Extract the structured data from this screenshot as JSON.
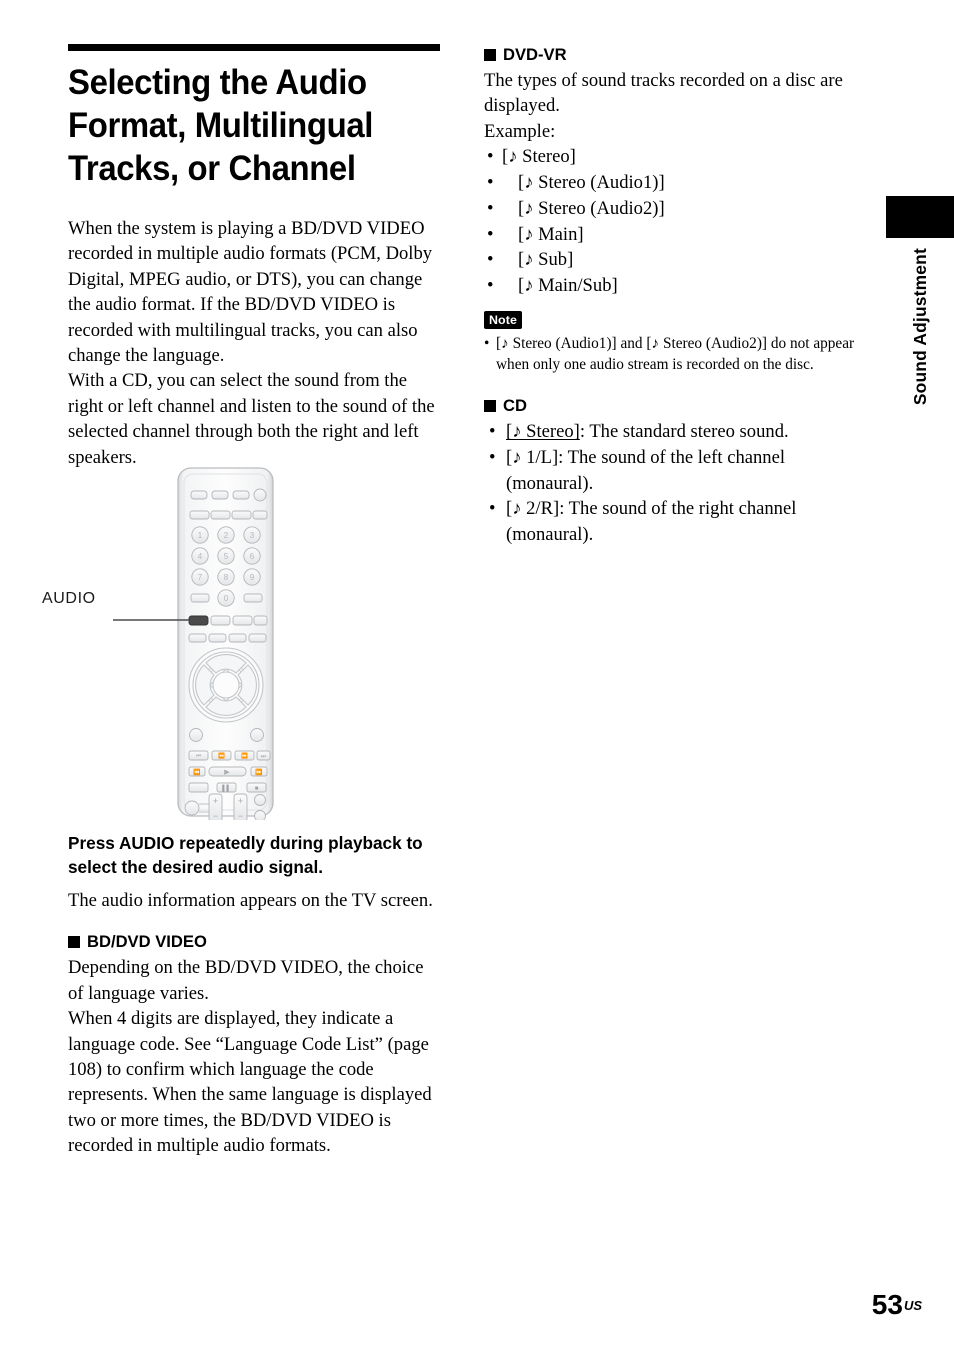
{
  "page": {
    "number": "53",
    "region_suffix": "US",
    "side_tab_label": "Sound Adjustment"
  },
  "left_column": {
    "title": "Selecting the Audio Format, Multilingual Tracks, or Channel",
    "intro_paragraphs": [
      "When the system is playing a BD/DVD VIDEO recorded in multiple audio formats (PCM, Dolby Digital, MPEG audio, or DTS), you can change the audio format. If the BD/DVD VIDEO is recorded with multilingual tracks, you can also change the language.",
      "With a CD, you can select the sound from the right or left channel and listen to the sound of the selected channel through both the right and left speakers."
    ],
    "figure": {
      "callout_label": "AUDIO",
      "keypad_digits": [
        "1",
        "2",
        "3",
        "4",
        "5",
        "6",
        "7",
        "8",
        "9",
        "0"
      ],
      "volume_plus": "+",
      "volume_minus": "−"
    },
    "instruction": "Press AUDIO repeatedly during playback to select the desired audio signal.",
    "instruction_body": "The audio information appears on the TV screen.",
    "bd_dvd_heading": "BD/DVD VIDEO",
    "bd_dvd_paragraphs": [
      "Depending on the BD/DVD VIDEO, the choice of language varies.",
      "When 4 digits are displayed, they indicate a language code. See “Language Code List” (page 108) to confirm which language the code represents. When the same language is displayed two or more times, the BD/DVD VIDEO is recorded in multiple audio formats."
    ]
  },
  "right_column": {
    "dvd_vr_heading": "DVD-VR",
    "dvd_vr_paragraphs": [
      "The types of sound tracks recorded on a disc are displayed.",
      "Example:"
    ],
    "dvd_vr_items": [
      "[♪ Stereo]",
      "[♪ Stereo (Audio1)]",
      "[♪ Stereo (Audio2)]",
      "[♪ Main]",
      "[♪ Sub]",
      "[♪ Main/Sub]"
    ],
    "note_badge": "Note",
    "note_items": [
      "[♪ Stereo (Audio1)] and [♪ Stereo (Audio2)] do not appear when only one audio stream is recorded on the disc."
    ],
    "cd_heading": "CD",
    "cd_items": [
      {
        "term": "[♪ Stereo]",
        "underline": true,
        "desc": ": The standard stereo sound."
      },
      {
        "term": "[♪ 1/L]",
        "underline": false,
        "desc": ": The sound of the left channel (monaural)."
      },
      {
        "term": "[♪ 2/R]",
        "underline": false,
        "desc": ": The sound of the right channel (monaural)."
      }
    ]
  }
}
